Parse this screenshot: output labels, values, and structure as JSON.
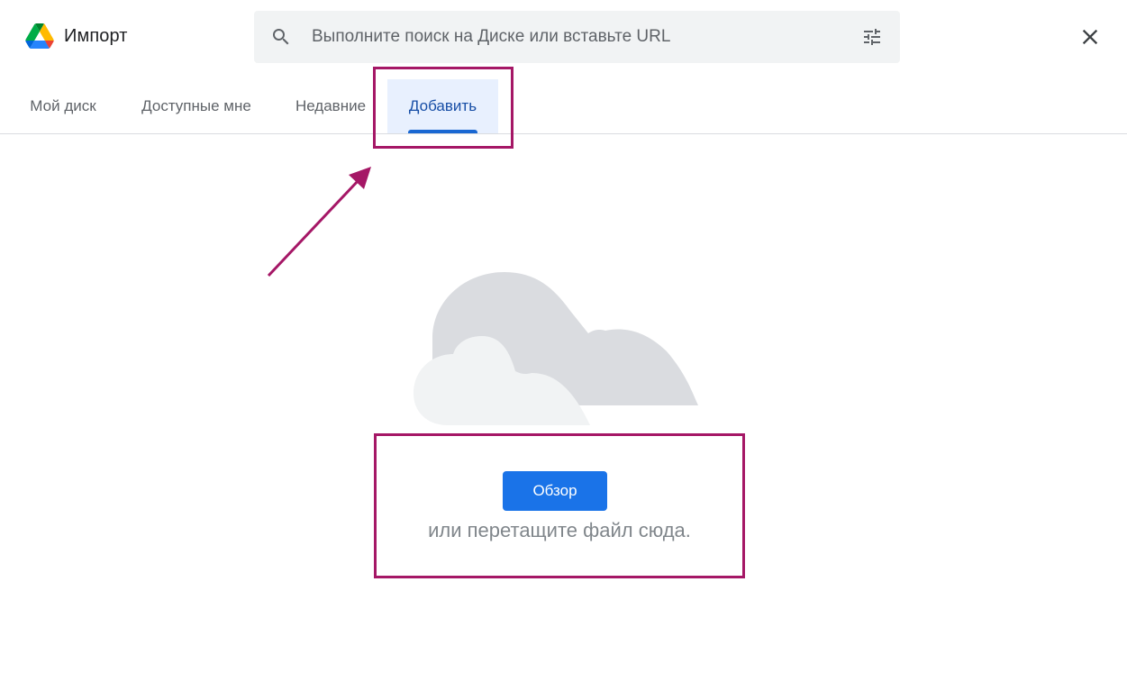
{
  "header": {
    "title": "Импорт",
    "logo_icon": "google-drive-icon",
    "search": {
      "placeholder": "Выполните поиск на Диске или вставьте URL",
      "value": ""
    },
    "filter_icon": "tune-icon",
    "close_icon": "close-icon"
  },
  "tabs": [
    {
      "label": "Мой диск",
      "active": false
    },
    {
      "label": "Доступные мне",
      "active": false
    },
    {
      "label": "Недавние",
      "active": false
    },
    {
      "label": "Добавить",
      "active": true
    }
  ],
  "upload": {
    "browse_label": "Обзор",
    "drop_text": "или перетащите файл сюда."
  },
  "colors": {
    "accent": "#1a73e8",
    "active_tab_bg": "#e8f0fe",
    "active_tab_text": "#174ea6",
    "annotation": "#a51766"
  }
}
